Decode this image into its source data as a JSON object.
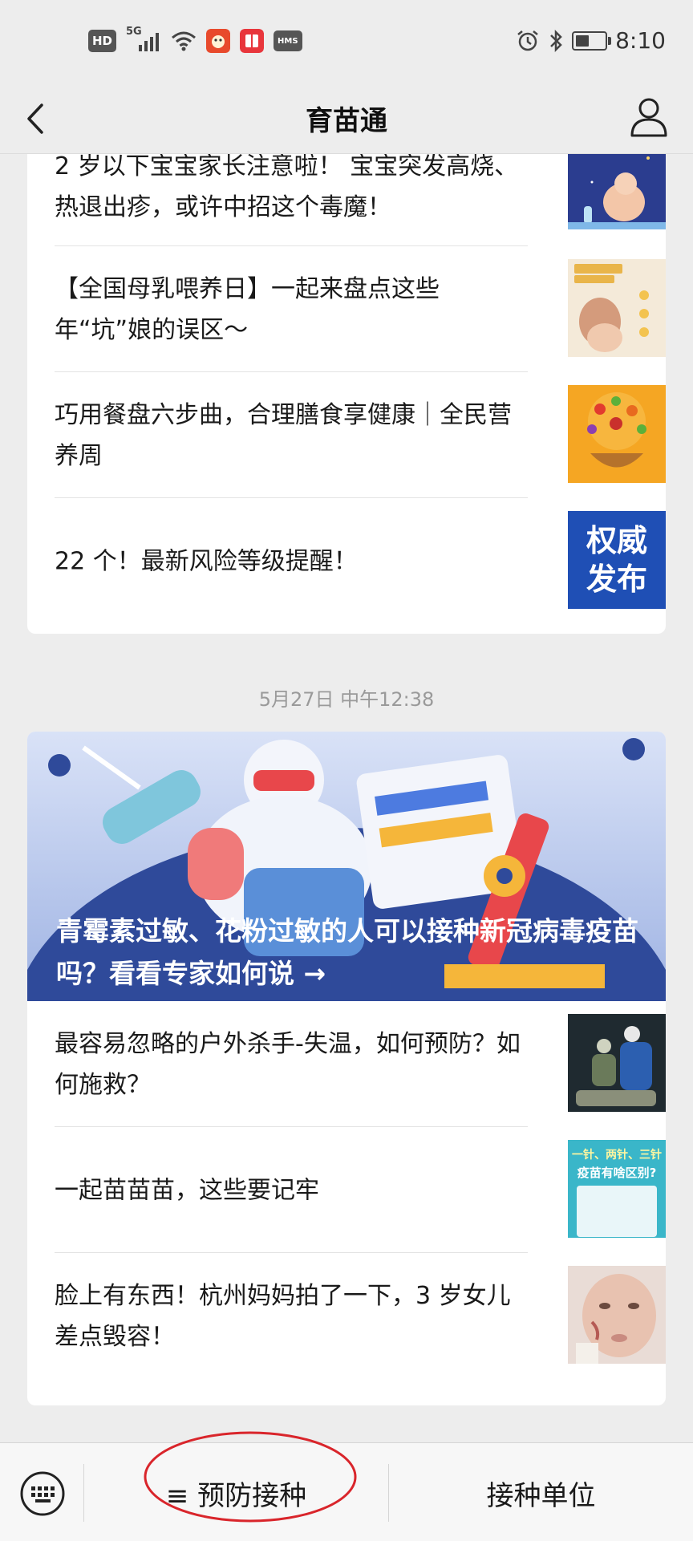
{
  "status_bar": {
    "hd": "HD",
    "network": "5G",
    "hms": "HMS",
    "time": "8:10"
  },
  "header": {
    "title": "育苗通"
  },
  "top_card": {
    "items": [
      {
        "title": "2 岁以下宝宝家长注意啦！ 宝宝突发高烧、热退出疹，或许中招这个毒魔！"
      },
      {
        "title": "【全国母乳喂养日】一起来盘点这些年“坑”娘的误区～"
      },
      {
        "title": "巧用餐盘六步曲，合理膳食享健康｜全民营养周"
      },
      {
        "title": "22 个！最新风险等级提醒！",
        "thumb_text_1": "权威",
        "thumb_text_2": "发布"
      }
    ]
  },
  "timestamp": "5月27日 中午12:38",
  "second_card": {
    "hero_title": "青霉素过敏、花粉过敏的人可以接种新冠病毒疫苗吗？看看专家如何说 →",
    "items": [
      {
        "title": "最容易忽略的户外杀手-失温，如何预防？如何施救？"
      },
      {
        "title": "一起苗苗苗，这些要记牢",
        "thumb_text_1": "一针、两针、三针",
        "thumb_text_2": "疫苗有啥区别?"
      },
      {
        "title": "脸上有东西！杭州妈妈拍了一下，3 岁女儿差点毁容！"
      }
    ]
  },
  "bottom_menu": {
    "menu1": "≡ 预防接种",
    "menu2": "接种单位"
  },
  "colors": {
    "background": "#ededed",
    "card": "#ffffff",
    "hero_blue": "#2f4a9a",
    "annotation_red": "#d9252b"
  }
}
